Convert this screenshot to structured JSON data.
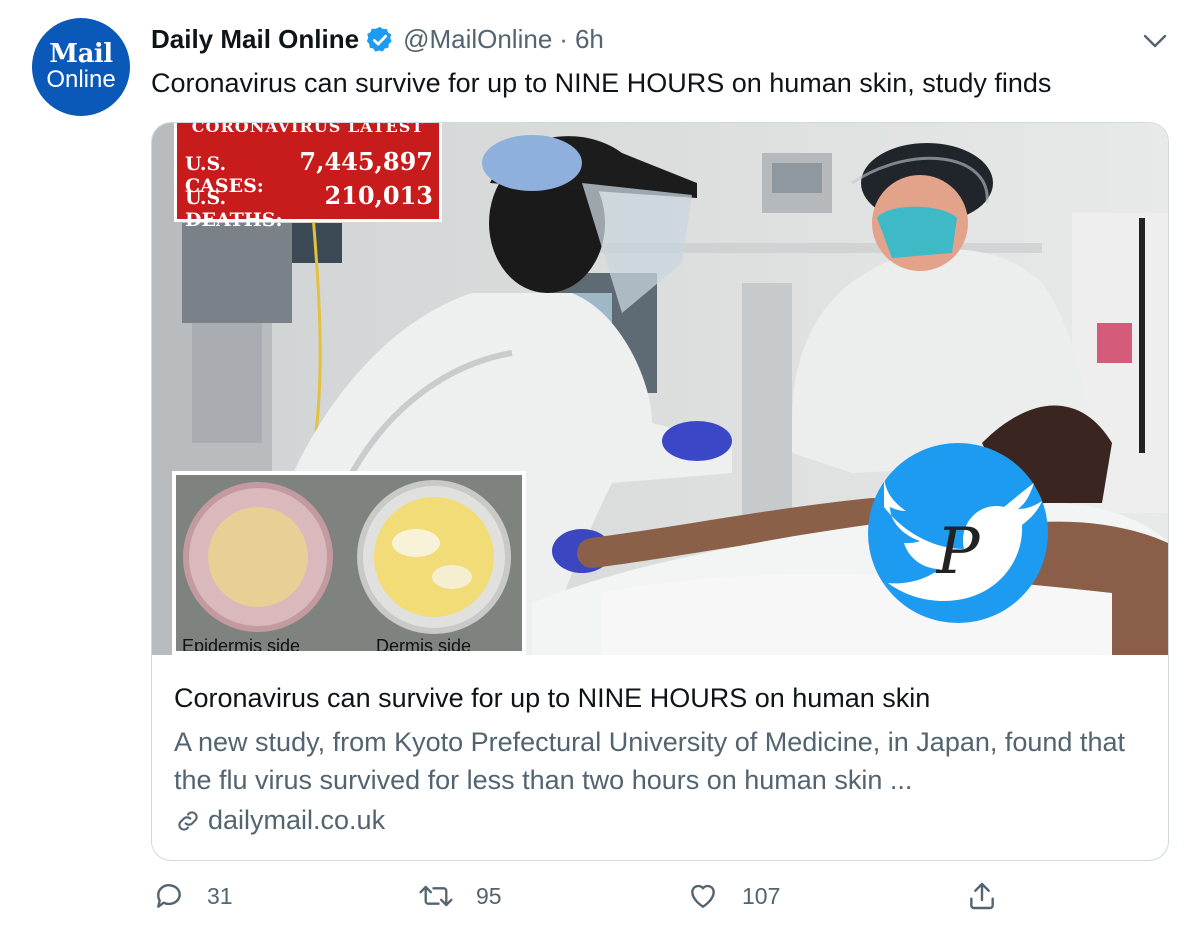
{
  "account": {
    "avatar_line1": "Mail",
    "avatar_line2": "Online",
    "display_name": "Daily Mail Online",
    "handle": "@MailOnline",
    "separator": "·",
    "time": "6h",
    "verified": true
  },
  "tweet": {
    "text": "Coronavirus can survive for up to NINE HOURS on human skin, study finds"
  },
  "card": {
    "banner_title": "CORONAVIRUS LATEST",
    "cases_label": "U.S. CASES:",
    "cases_value": "7,445,897",
    "deaths_label": "U.S. DEATHS:",
    "deaths_value": "210,013",
    "inset_left_caption": "Epidermis side",
    "inset_right_caption": "Dermis side",
    "watermark_letter": "P",
    "title": "Coronavirus can survive for up to NINE HOURS on human skin",
    "description": "A new study, from Kyoto Prefectural University of Medicine, in Japan, found that the flu virus survived for less than two hours on human skin ...",
    "link": "dailymail.co.uk"
  },
  "actions": {
    "reply_count": "31",
    "retweet_count": "95",
    "like_count": "107"
  },
  "icons": [
    "verified-badge-icon",
    "chevron-down-icon",
    "link-icon",
    "reply-icon",
    "retweet-icon",
    "like-icon",
    "share-icon",
    "twitter-bird-watermark-icon"
  ],
  "colors": {
    "brand": "#0a58b8",
    "verified": "#1d9bf0",
    "stats_red": "#c81b1b"
  }
}
